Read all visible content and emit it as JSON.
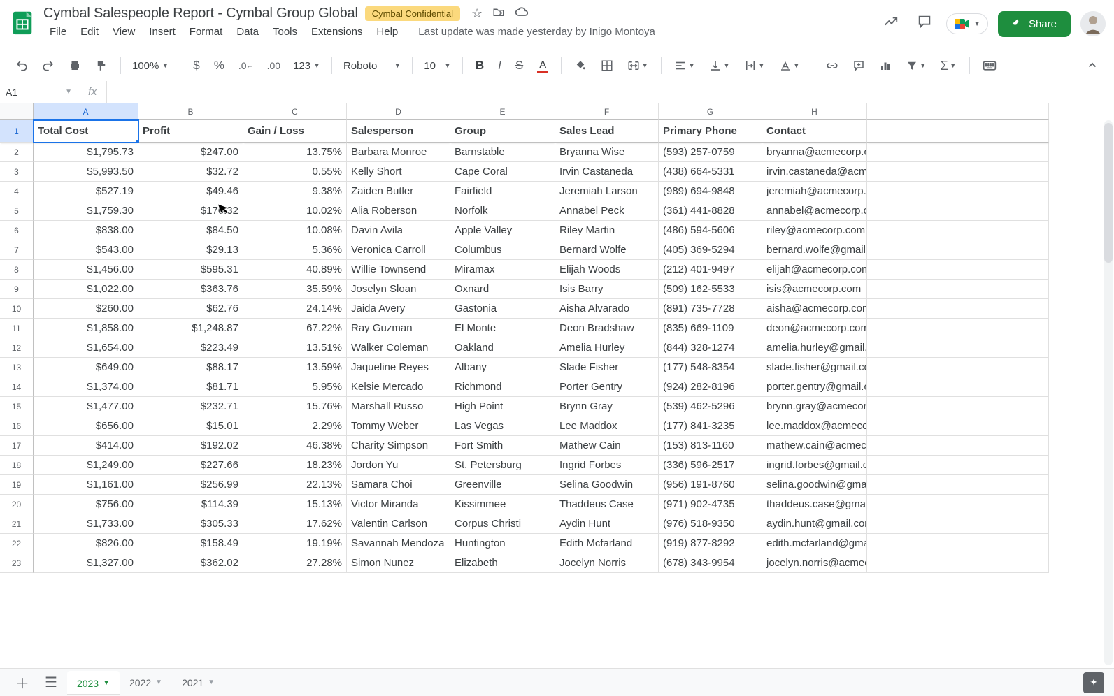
{
  "doc_title": "Cymbal Salespeople Report - Cymbal Group Global",
  "confidential": "Cymbal Confidential",
  "last_update": "Last update was made yesterday by Inigo Montoya",
  "menu": [
    "File",
    "Edit",
    "View",
    "Insert",
    "Format",
    "Data",
    "Tools",
    "Extensions",
    "Help"
  ],
  "share_label": "Share",
  "toolbar": {
    "zoom": "100%",
    "font": "Roboto",
    "font_size": "10",
    "format_123": "123"
  },
  "name_box": "A1",
  "col_letters": [
    "A",
    "B",
    "C",
    "D",
    "E",
    "F",
    "G",
    "H"
  ],
  "headers": [
    "Total Cost",
    "Profit",
    "Gain / Loss",
    "Salesperson",
    "Group",
    "Sales Lead",
    "Primary Phone",
    "Contact"
  ],
  "rows": [
    [
      "$1,795.73",
      "$247.00",
      "13.75%",
      "Barbara Monroe",
      "Barnstable",
      "Bryanna Wise",
      "(593) 257-0759",
      "bryanna@acmecorp.com"
    ],
    [
      "$5,993.50",
      "$32.72",
      "0.55%",
      "Kelly Short",
      "Cape Coral",
      "Irvin Castaneda",
      "(438) 664-5331",
      "irvin.castaneda@acmecorp.com"
    ],
    [
      "$527.19",
      "$49.46",
      "9.38%",
      "Zaiden Butler",
      "Fairfield",
      "Jeremiah Larson",
      "(989) 694-9848",
      "jeremiah@acmecorp.com"
    ],
    [
      "$1,759.30",
      "$176.32",
      "10.02%",
      "Alia Roberson",
      "Norfolk",
      "Annabel Peck",
      "(361) 441-8828",
      "annabel@acmecorp.com"
    ],
    [
      "$838.00",
      "$84.50",
      "10.08%",
      "Davin Avila",
      "Apple Valley",
      "Riley Martin",
      "(486) 594-5606",
      "riley@acmecorp.com"
    ],
    [
      "$543.00",
      "$29.13",
      "5.36%",
      "Veronica Carroll",
      "Columbus",
      "Bernard Wolfe",
      "(405) 369-5294",
      "bernard.wolfe@gmail.com"
    ],
    [
      "$1,456.00",
      "$595.31",
      "40.89%",
      "Willie Townsend",
      "Miramax",
      "Elijah Woods",
      "(212) 401-9497",
      "elijah@acmecorp.com"
    ],
    [
      "$1,022.00",
      "$363.76",
      "35.59%",
      "Joselyn Sloan",
      "Oxnard",
      "Isis Barry",
      "(509) 162-5533",
      "isis@acmecorp.com"
    ],
    [
      "$260.00",
      "$62.76",
      "24.14%",
      "Jaida Avery",
      "Gastonia",
      "Aisha Alvarado",
      "(891) 735-7728",
      "aisha@acmecorp.com"
    ],
    [
      "$1,858.00",
      "$1,248.87",
      "67.22%",
      "Ray Guzman",
      "El Monte",
      "Deon Bradshaw",
      "(835) 669-1109",
      "deon@acmecorp.com"
    ],
    [
      "$1,654.00",
      "$223.49",
      "13.51%",
      "Walker Coleman",
      "Oakland",
      "Amelia Hurley",
      "(844) 328-1274",
      "amelia.hurley@gmail.com"
    ],
    [
      "$649.00",
      "$88.17",
      "13.59%",
      "Jaqueline Reyes",
      "Albany",
      "Slade Fisher",
      "(177) 548-8354",
      "slade.fisher@gmail.com"
    ],
    [
      "$1,374.00",
      "$81.71",
      "5.95%",
      "Kelsie Mercado",
      "Richmond",
      "Porter Gentry",
      "(924) 282-8196",
      "porter.gentry@gmail.com"
    ],
    [
      "$1,477.00",
      "$232.71",
      "15.76%",
      "Marshall Russo",
      "High Point",
      "Brynn Gray",
      "(539) 462-5296",
      "brynn.gray@acmecorp.com"
    ],
    [
      "$656.00",
      "$15.01",
      "2.29%",
      "Tommy Weber",
      "Las Vegas",
      "Lee Maddox",
      "(177) 841-3235",
      "lee.maddox@acmecorp.com"
    ],
    [
      "$414.00",
      "$192.02",
      "46.38%",
      "Charity Simpson",
      "Fort Smith",
      "Mathew Cain",
      "(153) 813-1160",
      "mathew.cain@acmecorp.com"
    ],
    [
      "$1,249.00",
      "$227.66",
      "18.23%",
      "Jordon Yu",
      "St. Petersburg",
      "Ingrid Forbes",
      "(336) 596-2517",
      "ingrid.forbes@gmail.com"
    ],
    [
      "$1,161.00",
      "$256.99",
      "22.13%",
      "Samara Choi",
      "Greenville",
      "Selina Goodwin",
      "(956) 191-8760",
      "selina.goodwin@gmail.com"
    ],
    [
      "$756.00",
      "$114.39",
      "15.13%",
      "Victor Miranda",
      "Kissimmee",
      "Thaddeus Case",
      "(971) 902-4735",
      "thaddeus.case@gmail.com"
    ],
    [
      "$1,733.00",
      "$305.33",
      "17.62%",
      "Valentin Carlson",
      "Corpus Christi",
      "Aydin Hunt",
      "(976) 518-9350",
      "aydin.hunt@gmail.com"
    ],
    [
      "$826.00",
      "$158.49",
      "19.19%",
      "Savannah Mendoza",
      "Huntington",
      "Edith Mcfarland",
      "(919) 877-8292",
      "edith.mcfarland@gmail.com"
    ],
    [
      "$1,327.00",
      "$362.02",
      "27.28%",
      "Simon Nunez",
      "Elizabeth",
      "Jocelyn Norris",
      "(678) 343-9954",
      "jocelyn.norris@acmecorp.com"
    ]
  ],
  "sheet_tabs": [
    "2023",
    "2022",
    "2021"
  ],
  "active_tab": 0
}
